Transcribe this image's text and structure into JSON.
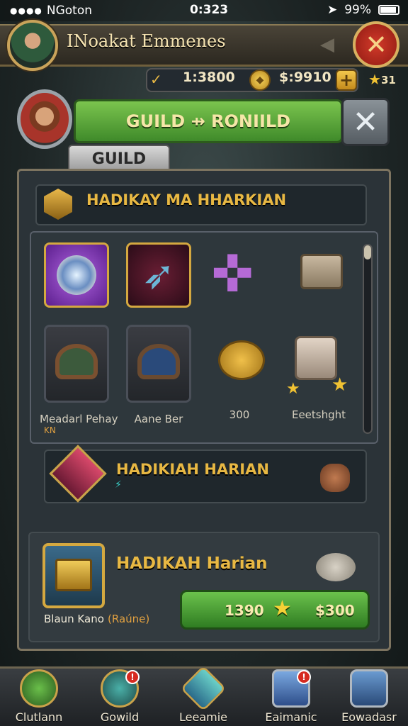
{
  "status_bar": {
    "carrier": "NGoton",
    "time": "0:323",
    "battery": "99%"
  },
  "header": {
    "title": "INoakat Emmenes"
  },
  "currency": {
    "primary": "1:3800",
    "secondary": "$:9910",
    "stars": "31"
  },
  "guild_header": {
    "title": "GUILD ⇸ RONIILD",
    "tab": "GUILD"
  },
  "section1": {
    "title": "HADIKAY MA HHARKIAN"
  },
  "items": [
    {
      "label": ""
    },
    {
      "label": ""
    },
    {
      "label": ""
    },
    {
      "label": ""
    },
    {
      "label": "Meadarl Pehay"
    },
    {
      "label": "Aane Ber"
    },
    {
      "label": "300"
    },
    {
      "label": "Eeetshght"
    }
  ],
  "sub_label": "KN",
  "section2": {
    "title": "HADIKIAH HARIAN"
  },
  "section3": {
    "title": "HADIKAH Harian",
    "reward_label": "Blaun Kano",
    "reward_tag": "(Raúne)"
  },
  "buy_button": {
    "left_value": "1390",
    "right_value": "$300"
  },
  "nav": [
    {
      "label": "Clutlann",
      "badge": ""
    },
    {
      "label": "Gowild",
      "badge": "!"
    },
    {
      "label": "Leeamie",
      "badge": ""
    },
    {
      "label": "Eaimanic",
      "badge": "!"
    },
    {
      "label": "Eowadasr",
      "badge": ""
    }
  ],
  "colors": {
    "accent_green": "#4fa236",
    "gold": "#e8b843",
    "close_red": "#c0302a"
  }
}
